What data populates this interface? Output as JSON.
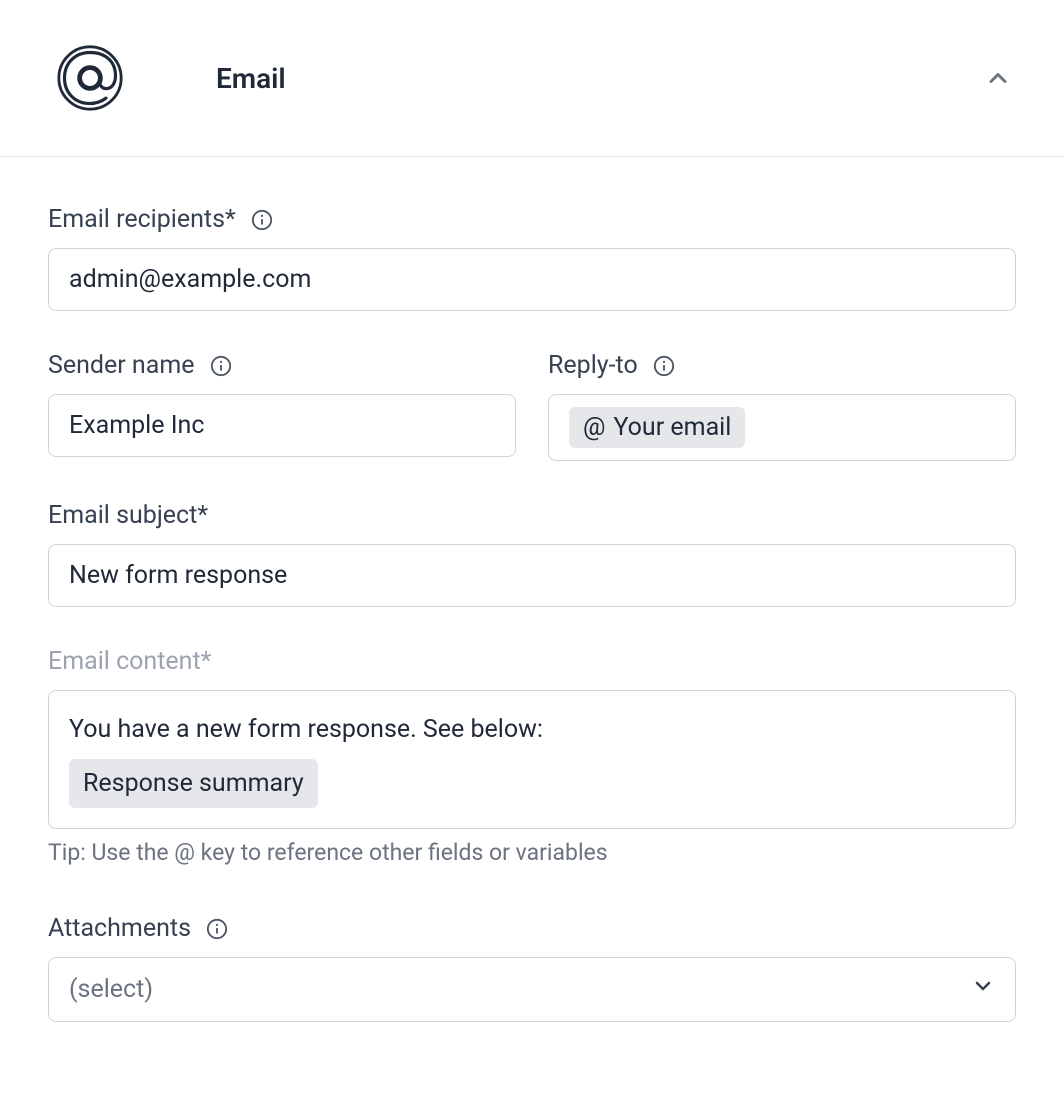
{
  "header": {
    "title": "Email"
  },
  "fields": {
    "recipients": {
      "label": "Email recipients*",
      "value": "admin@example.com"
    },
    "sender": {
      "label": "Sender name",
      "value": "Example Inc"
    },
    "reply_to": {
      "label": "Reply-to",
      "chip_prefix": "@",
      "chip_label": "Your email"
    },
    "subject": {
      "label": "Email subject*",
      "value": "New form response"
    },
    "content": {
      "label": "Email content*",
      "text": "You have a new form response. See below:",
      "chip_label": "Response summary",
      "hint": "Tip: Use the @ key to reference other fields or variables"
    },
    "attachments": {
      "label": "Attachments",
      "placeholder": "(select)"
    }
  }
}
